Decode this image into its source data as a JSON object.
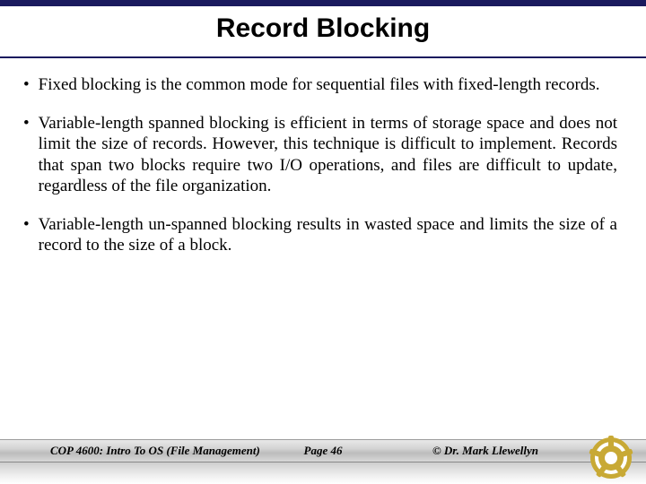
{
  "title": "Record Blocking",
  "bullets": [
    "Fixed blocking is the common mode for sequential files with fixed-length records.",
    "Variable-length spanned blocking is efficient in terms of storage space and does not limit the size of records.  However, this technique is difficult to implement.  Records that span two blocks require two I/O operations, and files are difficult to update, regardless of the file organization.",
    "Variable-length un-spanned blocking results in wasted space and limits the size of a record to the size of a block."
  ],
  "footer": {
    "course": "COP 4600: Intro To OS  (File Management)",
    "page": "Page 46",
    "copyright": "© Dr. Mark Llewellyn"
  }
}
